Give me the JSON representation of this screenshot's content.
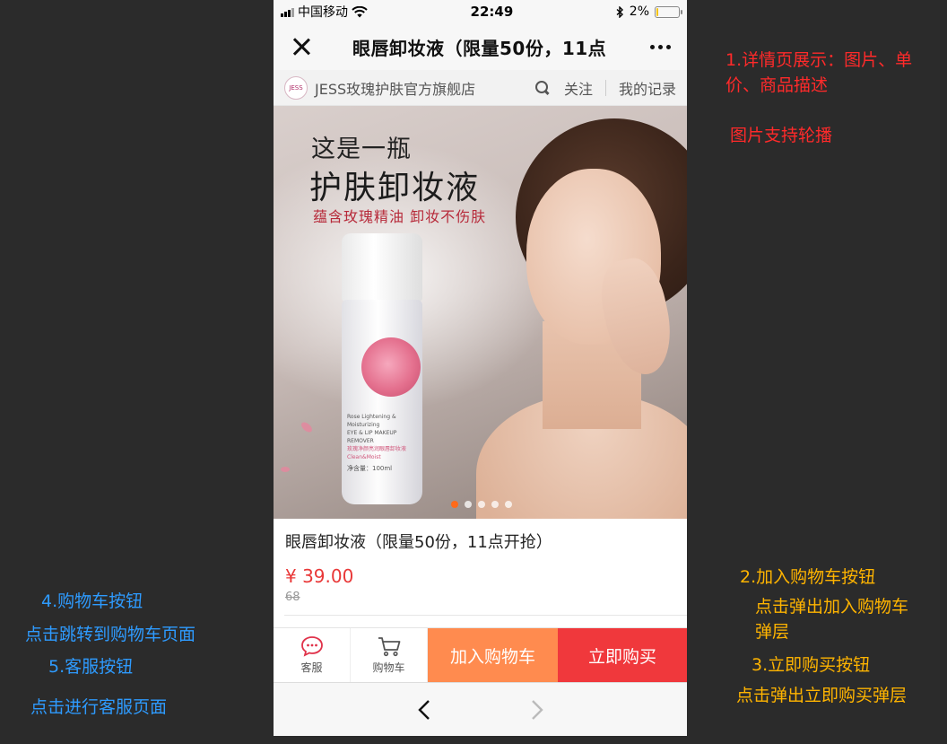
{
  "annotations": {
    "detail_title": "1.详情页展示：图片、单价、商品描述",
    "detail_title_line1": "1.详情页展示：图片、单",
    "detail_title_line2": "价、商品描述",
    "carousel_note": "图片支持轮播",
    "add_cart_title": "2.加入购物车按钮",
    "add_cart_desc_line1": "点击弹出加入购物车",
    "add_cart_desc_line2": "弹层",
    "buy_now_title": "3.立即购买按钮",
    "buy_now_desc": "点击弹出立即购买弹层",
    "cart_title": "4.购物车按钮",
    "cart_desc": "点击跳转到购物车页面",
    "service_title": "5.客服按钮",
    "service_desc": "点击进行客服页面"
  },
  "status_bar": {
    "carrier": "中国移动",
    "time": "22:49",
    "battery": "2%",
    "battery_level": 0.02
  },
  "nav": {
    "title": "眼唇卸妆液（限量50份，11点"
  },
  "shop": {
    "logo_text": "JESS",
    "name": "JESS玫瑰护肤官方旗舰店",
    "follow": "关注",
    "record": "我的记录"
  },
  "banner": {
    "line1": "这是一瓶",
    "line2": "护肤卸妆液",
    "line3": "蕴含玫瑰精油 卸妆不伤肤",
    "bottle_text_1": "Rose Lightening & Moisturizing",
    "bottle_text_2": "EYE & LIP MAKEUP REMOVER",
    "bottle_text_3": "玫瑰净颜亮润眼唇卸妆液",
    "bottle_text_4": "Clean&Moist",
    "bottle_text_5": "净含量：100ml",
    "slide_count": 5,
    "active_slide": 1
  },
  "product": {
    "title": "眼唇卸妆液（限量50份，11点开抢）",
    "price": "¥ 39.00",
    "original_price": "68"
  },
  "actions": {
    "service_label": "客服",
    "cart_label": "购物车",
    "add_to_cart": "加入购物车",
    "buy_now": "立即购买"
  },
  "colors": {
    "price_red": "#e93838",
    "add_cart_orange": "#ff8b4f",
    "buy_now_red": "#f0383c",
    "note_red": "#ff2a2a",
    "note_blue": "#2e9bff",
    "note_orange": "#ffb400",
    "active_dot": "#ff6a1a"
  }
}
